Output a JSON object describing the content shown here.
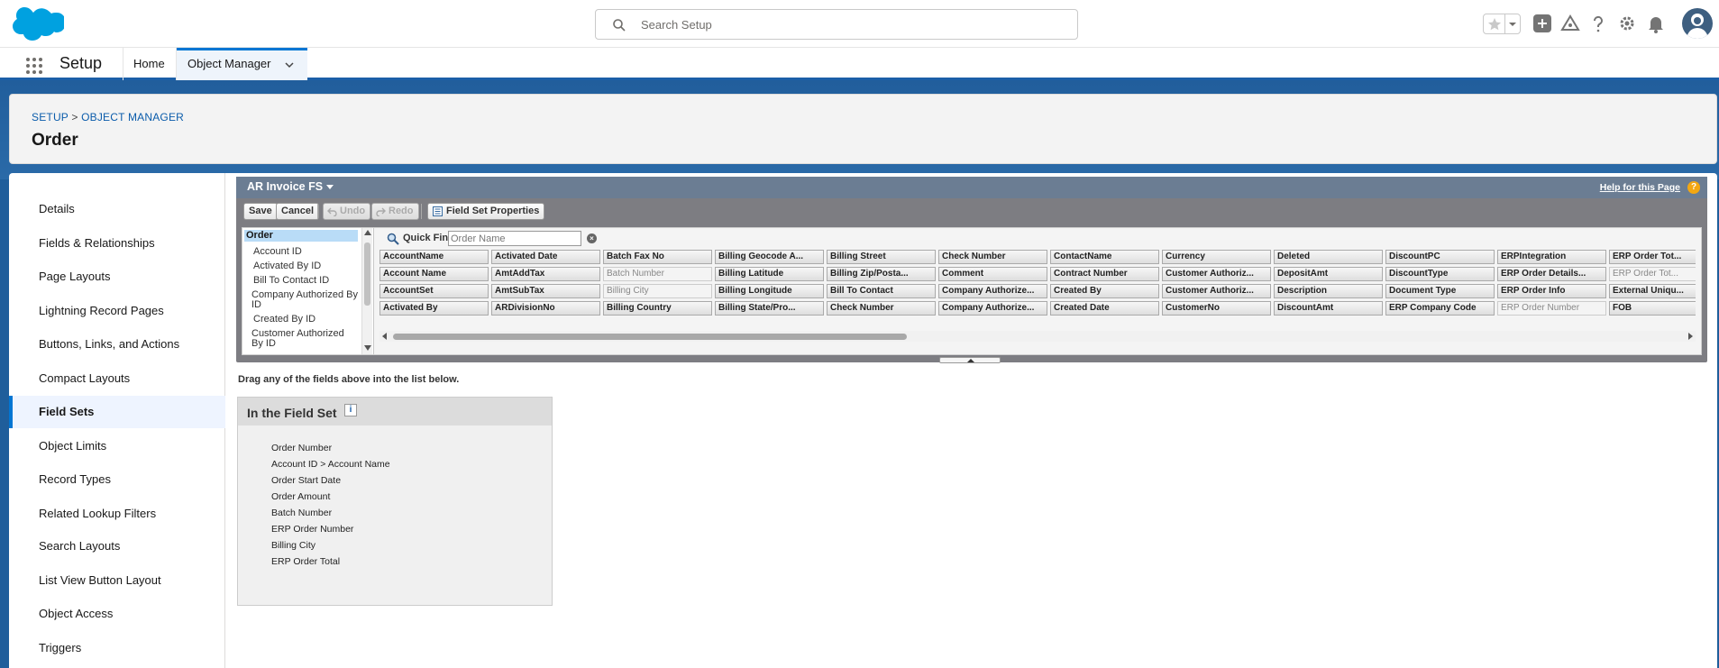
{
  "header": {
    "search_placeholder": "Search Setup",
    "icons": [
      "favorites-star-icon",
      "favorites-dropdown-icon",
      "add-icon",
      "trailhead-icon",
      "help-icon",
      "setup-gear-icon",
      "notifications-bell-icon",
      "avatar-icon"
    ]
  },
  "app_nav": {
    "app_name": "Setup",
    "tabs": [
      {
        "label": "Home"
      },
      {
        "label": "Object Manager"
      }
    ]
  },
  "page_header": {
    "breadcrumb": {
      "root": "SETUP",
      "separator": ">",
      "child": "OBJECT MANAGER"
    },
    "title": "Order"
  },
  "left_nav": {
    "items": [
      {
        "label": "Details"
      },
      {
        "label": "Fields & Relationships"
      },
      {
        "label": "Page Layouts"
      },
      {
        "label": "Lightning Record Pages"
      },
      {
        "label": "Buttons, Links, and Actions"
      },
      {
        "label": "Compact Layouts"
      },
      {
        "label": "Field Sets"
      },
      {
        "label": "Object Limits"
      },
      {
        "label": "Record Types"
      },
      {
        "label": "Related Lookup Filters"
      },
      {
        "label": "Search Layouts"
      },
      {
        "label": "List View Button Layout"
      },
      {
        "label": "Object Access"
      },
      {
        "label": "Triggers"
      }
    ],
    "active": "Field Sets"
  },
  "editor": {
    "title": "AR Invoice FS",
    "help_link": "Help for this Page",
    "help_icon": "?",
    "toolbar": {
      "save": "Save",
      "cancel": "Cancel",
      "undo": "Undo",
      "redo": "Redo",
      "properties": "Field Set Properties"
    },
    "tree": {
      "root": "Order",
      "children": [
        "Account ID",
        "Activated By ID",
        "Bill To Contact ID",
        "Company Authorized By ID",
        "Created By ID",
        "Customer Authorized By ID"
      ]
    },
    "quick_find": {
      "label": "Quick Find",
      "placeholder": "Order Name",
      "clear": "×"
    },
    "fields_grid": [
      [
        "AccountName",
        "Activated Date",
        "Batch Fax No",
        "Billing Geocode A...",
        "Billing Street",
        "Check Number",
        "ContactName",
        "Currency",
        "Deleted",
        "DiscountPC",
        "ERPIntegration",
        "ERP Order Tot..."
      ],
      [
        "Account Name",
        "AmtAddTax",
        "Batch Number",
        "Billing Latitude",
        "Billing Zip/Posta...",
        "Comment",
        "Contract Number",
        "Customer Authoriz...",
        "DepositAmt",
        "DiscountType",
        "ERP Order Details...",
        "ERP Order Tot..."
      ],
      [
        "AccountSet",
        "AmtSubTax",
        "Billing City",
        "Billing Longitude",
        "Bill To Contact",
        "Company Authorize...",
        "Created By",
        "Customer Authoriz...",
        "Description",
        "Document Type",
        "ERP Order Info",
        "External Uniqu..."
      ],
      [
        "Activated By",
        "ARDivisionNo",
        "Billing Country",
        "Billing State/Pro...",
        "Check Number",
        "Company Authorize...",
        "Created Date",
        "CustomerNo",
        "DiscountAmt",
        "ERP Company Code",
        "ERP Order Number",
        "FOB"
      ]
    ],
    "used_fields": [
      "Batch Number",
      "Billing City",
      "ERP Order Number",
      "ERP Order Tot..."
    ]
  },
  "drag_hint": "Drag any of the fields above into the list below.",
  "field_set": {
    "title": "In the Field Set",
    "info_icon": "i",
    "items": [
      "Order Number",
      "Account ID > Account Name",
      "Order Start Date",
      "Order Amount",
      "Batch Number",
      "ERP Order Number",
      "Billing City",
      "ERP Order Total"
    ]
  }
}
